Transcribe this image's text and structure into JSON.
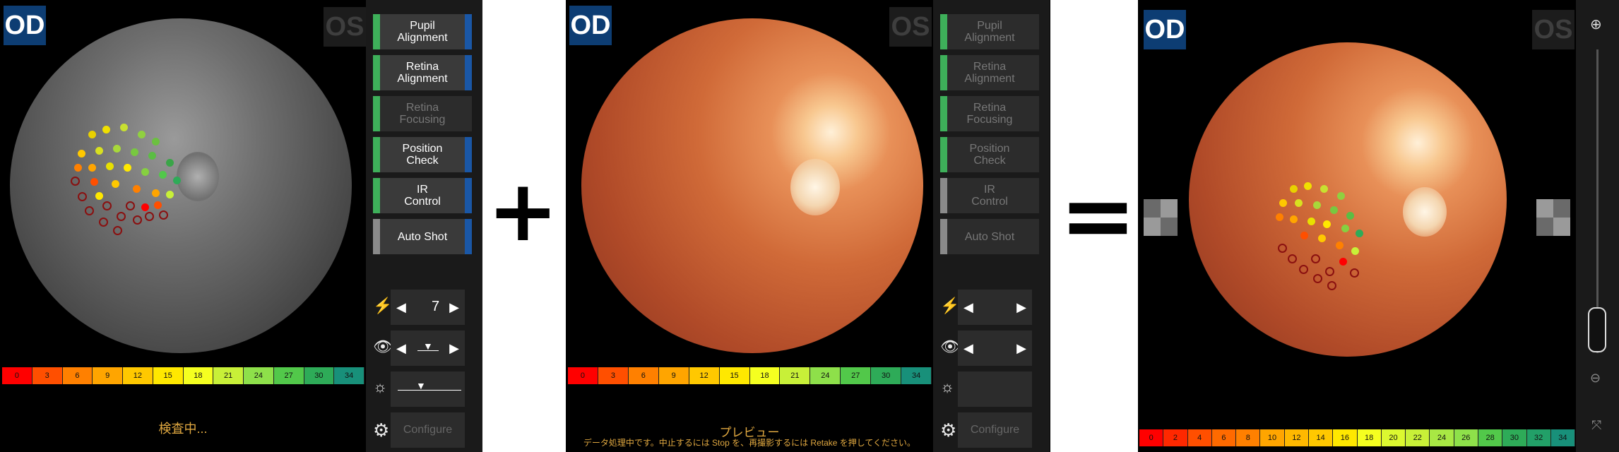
{
  "eye_labels": {
    "right": "OD",
    "left": "OS"
  },
  "panels": {
    "left": {
      "buttons": [
        {
          "label": "Pupil\nAlignment"
        },
        {
          "label": "Retina\nAlignment"
        },
        {
          "label": "Retina\nFocusing"
        },
        {
          "label": "Position\nCheck"
        },
        {
          "label": "IR\nControl"
        },
        {
          "label": "Auto Shot"
        }
      ],
      "flash_value": "7",
      "configure_label": "Configure",
      "status_text": "検査中...",
      "scale": [
        "0",
        "3",
        "6",
        "9",
        "12",
        "15",
        "18",
        "21",
        "24",
        "27",
        "30",
        "34"
      ]
    },
    "middle": {
      "buttons": [
        {
          "label": "Pupil\nAlignment"
        },
        {
          "label": "Retina\nAlignment"
        },
        {
          "label": "Retina\nFocusing"
        },
        {
          "label": "Position\nCheck"
        },
        {
          "label": "IR\nControl"
        },
        {
          "label": "Auto Shot"
        }
      ],
      "configure_label": "Configure",
      "status_title": "プレビュー",
      "status_text": "データ処理中です。中止するには Stop を、再撮影するには Retake を押してください。",
      "scale": [
        "0",
        "3",
        "6",
        "9",
        "12",
        "15",
        "18",
        "21",
        "24",
        "27",
        "30",
        "34"
      ]
    },
    "right": {
      "scale": [
        "0",
        "2",
        "4",
        "6",
        "8",
        "10",
        "12",
        "14",
        "16",
        "18",
        "20",
        "22",
        "24",
        "26",
        "28",
        "30",
        "32",
        "34"
      ]
    }
  },
  "operators": {
    "plus": "+",
    "equals": "="
  },
  "icons": {
    "flash": "flash-icon",
    "eye": "eye-icon",
    "brightness": "brightness-icon",
    "settings": "gear-icon",
    "zoom_in": "zoom-in-icon",
    "zoom_out": "zoom-out-icon",
    "fit": "fit-screen-icon"
  },
  "scale_colors": [
    "#ff0000",
    "#ff4f00",
    "#ff8000",
    "#ffa500",
    "#ffc800",
    "#ffe800",
    "#f5ff20",
    "#c8f038",
    "#8ee04a",
    "#52c84a",
    "#2eab58",
    "#18907a"
  ]
}
